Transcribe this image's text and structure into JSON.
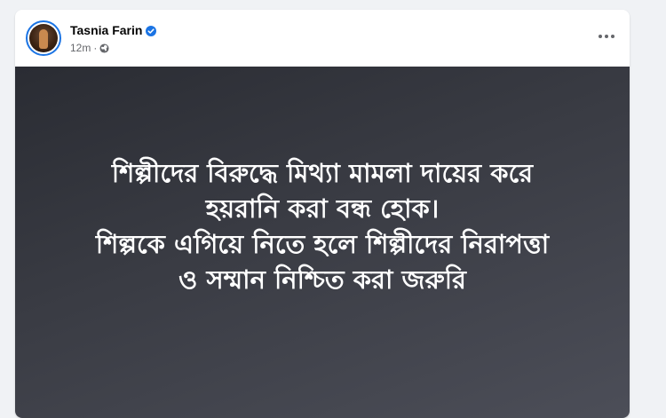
{
  "post": {
    "author": {
      "name": "Tasnia Farin",
      "verified": true,
      "verified_color": "#1b74e4"
    },
    "meta": {
      "time": "12m",
      "separator": "·",
      "audience_icon": "globe-icon"
    },
    "more_icon": "more-horizontal-icon",
    "media": {
      "background_gradient": [
        "#2a2c33",
        "#4c4e58"
      ],
      "text_color": "#ffffff",
      "lines": [
        "শিল্পীদের বিরুদ্ধে মিথ্যা মামলা দায়ের করে",
        "হয়রানি করা বন্ধ হোক।",
        "শিল্পকে এগিয়ে নিতে হলে শিল্পীদের নিরাপত্তা",
        "ও সম্মান নিশ্চিত করা জরুরি"
      ]
    }
  }
}
